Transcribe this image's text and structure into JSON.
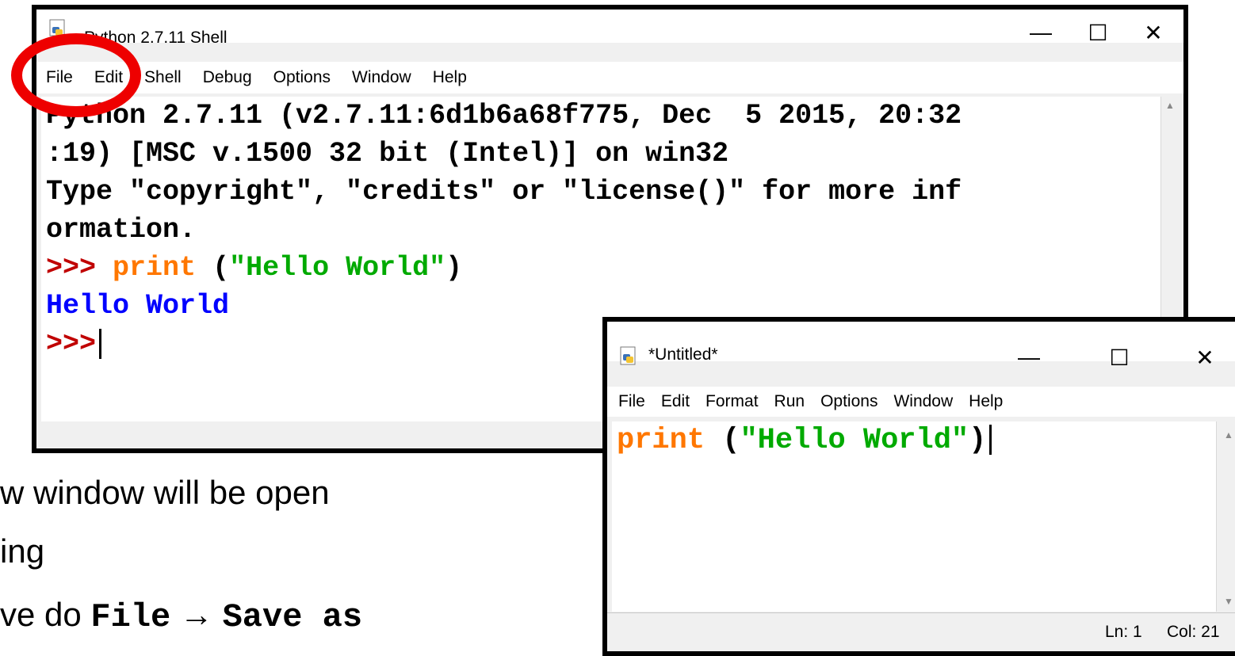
{
  "slide": {
    "line1": "w window will be open",
    "line2": "ing",
    "line3_prefix": "ve do ",
    "line3_file": "File",
    "line3_arrow": "→",
    "line3_save": "Save as"
  },
  "shell_window": {
    "title": "Python 2.7.11 Shell",
    "menu": [
      "File",
      "Edit",
      "Shell",
      "Debug",
      "Options",
      "Window",
      "Help"
    ],
    "controls": {
      "minimize": "—",
      "maximize": "☐",
      "close": "✕"
    },
    "lines": {
      "l1": "Python 2.7.11 (v2.7.11:6d1b6a68f775, Dec  5 2015, 20:32",
      "l2": ":19) [MSC v.1500 32 bit (Intel)] on win32",
      "l3": "Type \"copyright\", \"credits\" or \"license()\" for more inf",
      "l4": "ormation.",
      "prompt": ">>>",
      "kw_print": "print",
      "paren_open": "(",
      "string": "\"Hello World\"",
      "paren_close": ")",
      "output": "Hello World"
    }
  },
  "editor_window": {
    "title": "*Untitled*",
    "menu": [
      "File",
      "Edit",
      "Format",
      "Run",
      "Options",
      "Window",
      "Help"
    ],
    "controls": {
      "minimize": "—",
      "maximize": "☐",
      "close": "✕"
    },
    "code": {
      "kw_print": "print",
      "paren_open": "(",
      "string": "\"Hello World\"",
      "paren_close": ")"
    },
    "status": {
      "line": "Ln: 1",
      "col": "Col: 21"
    }
  },
  "annotation": {
    "color": "#ee0000"
  },
  "colors": {
    "keyword": "#ff7700",
    "string": "#00aa00",
    "prompt": "#c00000",
    "output": "#0000ff"
  }
}
